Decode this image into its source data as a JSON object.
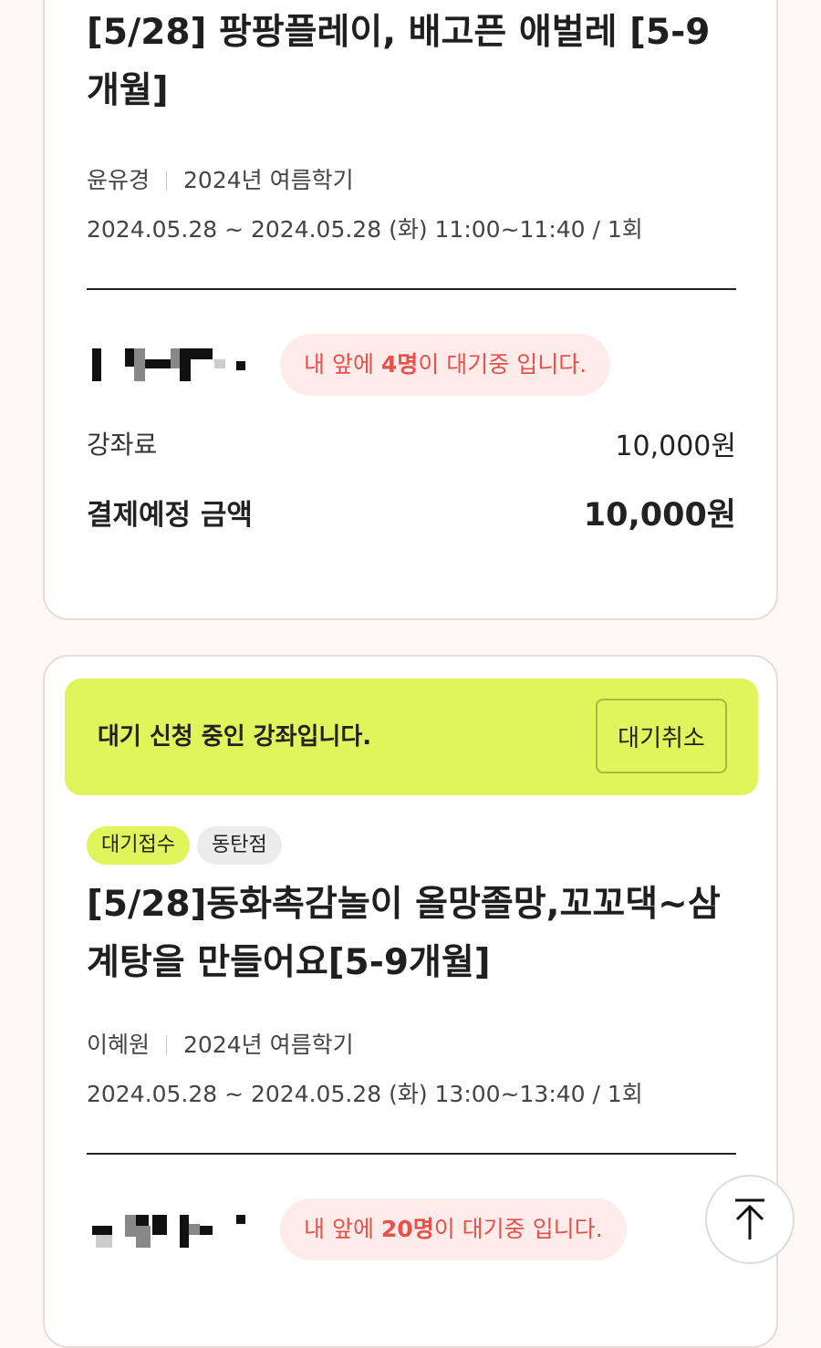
{
  "courses": [
    {
      "title": "[5/28] 팡팡플레이, 배고픈 애벌레 [5-9개월]",
      "instructor": "윤유경",
      "term": "2024년 여름학기",
      "schedule": "2024.05.28 ~ 2024.05.28 (화) 11:00~11:40 / 1회",
      "waitlist": {
        "prefix": "내 앞에 ",
        "count": "4명",
        "suffix": "이 대기중 입니다."
      },
      "fee_label": "강좌료",
      "fee_value": "10,000원",
      "total_label": "결제예정 금액",
      "total_value": "10,000원"
    },
    {
      "banner_text": "대기 신청 중인 강좌입니다.",
      "cancel_label": "대기취소",
      "badges": [
        "대기접수",
        "동탄점"
      ],
      "title": "[5/28]동화촉감놀이 올망졸망,꼬꼬댁~삼계탕을 만들어요[5-9개월]",
      "instructor": "이혜원",
      "term": "2024년 여름학기",
      "schedule": "2024.05.28 ~ 2024.05.28 (화) 13:00~13:40 / 1회",
      "waitlist": {
        "prefix": "내 앞에 ",
        "count": "20명",
        "suffix": "이 대기중 입니다."
      }
    }
  ],
  "scroll_top": {
    "icon": "arrow-up-to-top-icon"
  },
  "colors": {
    "background": "#fdf8f5",
    "banner": "#e0f55c",
    "waitlist_text": "#e8504a",
    "waitlist_bg": "#fdecea"
  }
}
